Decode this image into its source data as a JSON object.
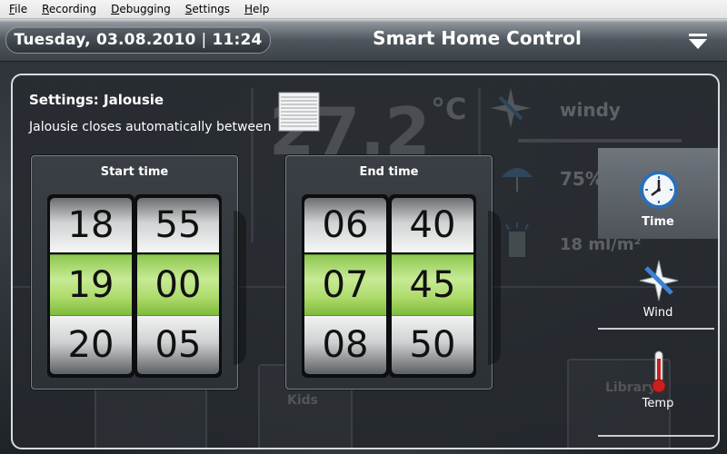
{
  "menubar": {
    "items": [
      {
        "accel": "F",
        "rest": "ile"
      },
      {
        "accel": "R",
        "rest": "ecording"
      },
      {
        "accel": "D",
        "rest": "ebugging"
      },
      {
        "accel": "S",
        "rest": "ettings"
      },
      {
        "accel": "H",
        "rest": "elp"
      }
    ]
  },
  "header": {
    "date": "Tuesday, 03.08.2010",
    "separator": "|",
    "time": "11:24",
    "title": "Smart Home Control",
    "menu_icon": "triangle-down-menu-icon"
  },
  "settings": {
    "title": "Settings: Jalousie",
    "description": "Jalousie closes automatically between",
    "icon": "jalousie-blinds-icon"
  },
  "start_time": {
    "title": "Start time",
    "hours": {
      "prev": "18",
      "selected": "19",
      "next": "20"
    },
    "minutes": {
      "prev": "55",
      "selected": "00",
      "next": "05"
    }
  },
  "end_time": {
    "title": "End time",
    "hours": {
      "prev": "06",
      "selected": "07",
      "next": "08"
    },
    "minutes": {
      "prev": "40",
      "selected": "45",
      "next": "50"
    }
  },
  "background_widgets": {
    "temperature": "27.2",
    "unit": "°C",
    "wind": "windy",
    "humidity": "75%",
    "rain": "18 ml/m²",
    "rooms": [
      "Kids",
      "Library"
    ]
  },
  "sidebar": {
    "items": [
      {
        "label": "Time",
        "icon": "clock-icon",
        "active": true
      },
      {
        "label": "Wind",
        "icon": "compass-wind-icon",
        "active": false
      },
      {
        "label": "Temp",
        "icon": "thermometer-icon",
        "active": false
      }
    ]
  },
  "colors": {
    "selected_row": "#aedb6b",
    "header": "#4f565d",
    "panel_border": "#d8dcdf"
  }
}
